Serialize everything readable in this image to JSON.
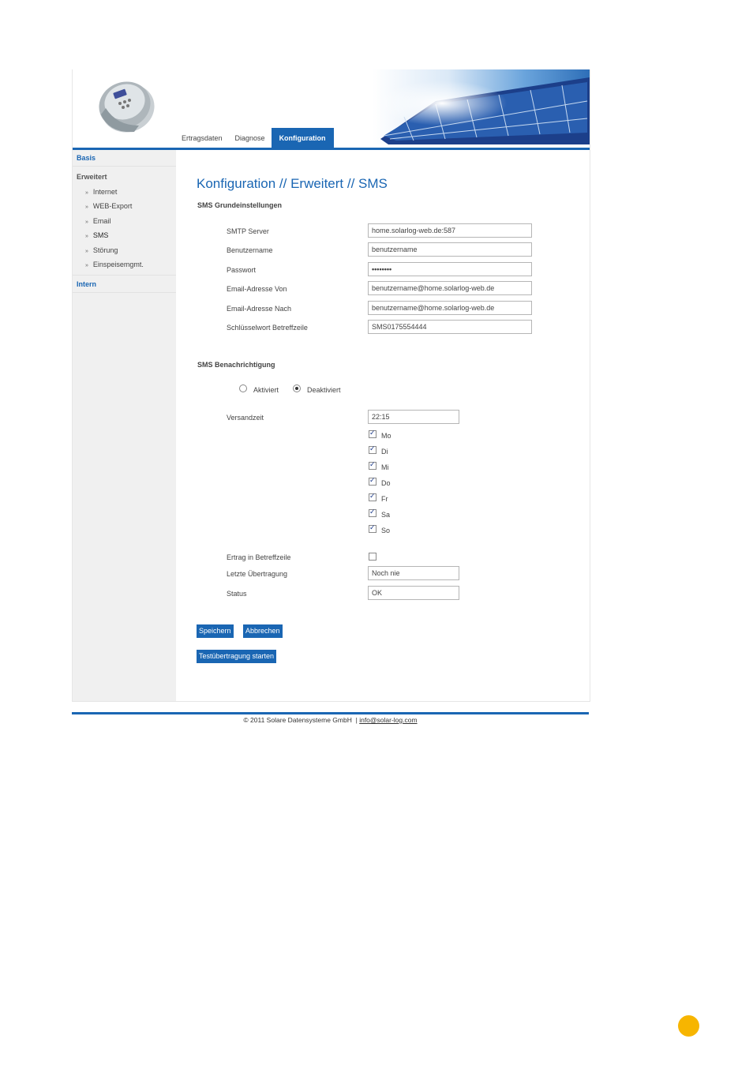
{
  "nav": {
    "tabs": [
      {
        "label": "Ertragsdaten"
      },
      {
        "label": "Diagnose"
      },
      {
        "label": "Konfiguration"
      }
    ]
  },
  "sidebar": {
    "basis": "Basis",
    "erweitert": "Erweitert",
    "items": [
      {
        "label": "Internet"
      },
      {
        "label": "WEB-Export"
      },
      {
        "label": "Email"
      },
      {
        "label": "SMS"
      },
      {
        "label": "Störung"
      },
      {
        "label": "Einspeisemgmt."
      }
    ],
    "intern": "Intern",
    "bullet": "»"
  },
  "page": {
    "title": "Konfiguration // Erweitert // SMS",
    "section1": "SMS Grundeinstellungen",
    "section2": "SMS Benachrichtigung"
  },
  "fields": {
    "smtp_label": "SMTP Server",
    "smtp_value": "home.solarlog-web.de:587",
    "user_label": "Benutzername",
    "user_value": "benutzername",
    "pass_label": "Passwort",
    "pass_value": "••••••••",
    "from_label": "Email-Adresse Von",
    "from_value": "benutzername@home.solarlog-web.de",
    "to_label": "Email-Adresse Nach",
    "to_value": "benutzername@home.solarlog-web.de",
    "keyword_label": "Schlüsselwort Betreffzeile",
    "keyword_value": "SMS0175554444"
  },
  "notify": {
    "radio_on": "Aktiviert",
    "radio_off": "Deaktiviert",
    "selected": "Deaktiviert",
    "time_label": "Versandzeit",
    "time_value": "22:15",
    "days": [
      {
        "label": "Mo",
        "checked": true
      },
      {
        "label": "Di",
        "checked": true
      },
      {
        "label": "Mi",
        "checked": true
      },
      {
        "label": "Do",
        "checked": true
      },
      {
        "label": "Fr",
        "checked": true
      },
      {
        "label": "Sa",
        "checked": true
      },
      {
        "label": "So",
        "checked": true
      }
    ],
    "yield_label": "Ertrag in Betreffzeile",
    "yield_checked": false,
    "last_label": "Letzte Übertragung",
    "last_value": "Noch nie",
    "status_label": "Status",
    "status_value": "OK"
  },
  "buttons": {
    "save": "Speichern",
    "cancel": "Abbrechen",
    "test": "Testübertragung starten"
  },
  "footer": {
    "copyright": "© 2011 Solare Datensysteme GmbH",
    "separator": "|",
    "email": "info@solar-log.com"
  },
  "colors": {
    "accent": "#1a66b3",
    "page_marker": "#f7b500"
  }
}
